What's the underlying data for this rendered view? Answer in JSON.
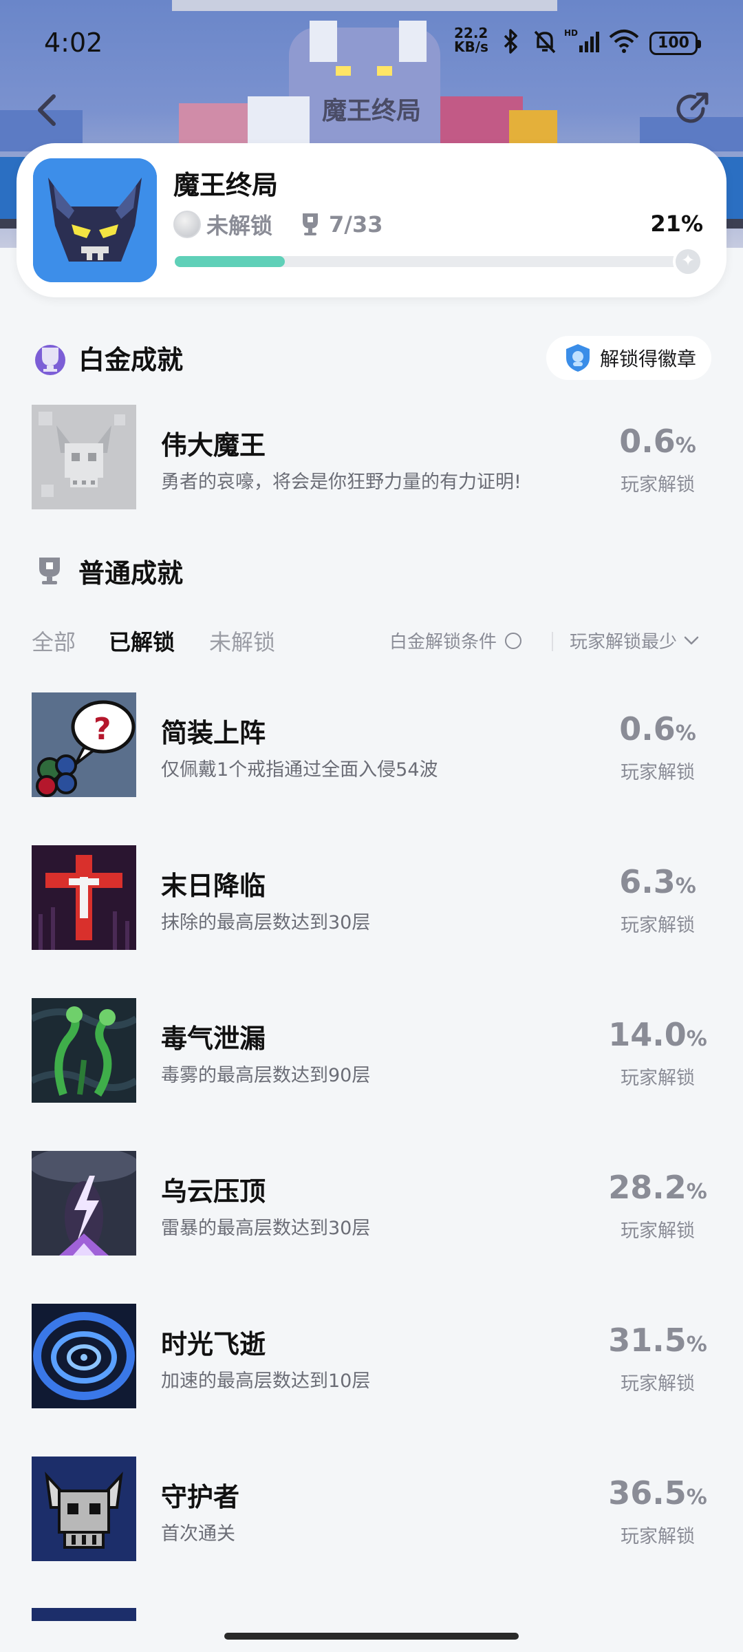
{
  "status_bar": {
    "time": "4:02",
    "net_speed_top": "22.2",
    "net_speed_unit": "KB/s",
    "battery": "100"
  },
  "nav": {
    "title": "魔王终局"
  },
  "game": {
    "name": "魔王终局",
    "platinum_status": "未解锁",
    "trophy_progress": "7/33",
    "percent_text": "21%",
    "progress_fraction": 0.21
  },
  "platinum_section": {
    "title": "白金成就",
    "badge_button": "解锁得徽章",
    "item": {
      "name": "伟大魔王",
      "desc": "勇者的哀嚎，将会是你狂野力量的有力证明!",
      "rate": "0.6",
      "pct": "%",
      "rate_label": "玩家解锁"
    }
  },
  "normal_section": {
    "title": "普通成就",
    "tabs": [
      "全部",
      "已解锁",
      "未解锁"
    ],
    "active_tab_index": 1,
    "condition_label": "白金解锁条件",
    "sort_label": "玩家解锁最少"
  },
  "achievements": [
    {
      "name": "简装上阵",
      "desc": "仅佩戴1个戒指通过全面入侵54波",
      "rate": "0.6",
      "pct": "%",
      "rate_label": "玩家解锁"
    },
    {
      "name": "末日降临",
      "desc": "抹除的最高层数达到30层",
      "rate": "6.3",
      "pct": "%",
      "rate_label": "玩家解锁"
    },
    {
      "name": "毒气泄漏",
      "desc": "毒雾的最高层数达到90层",
      "rate": "14.0",
      "pct": "%",
      "rate_label": "玩家解锁"
    },
    {
      "name": "乌云压顶",
      "desc": "雷暴的最高层数达到30层",
      "rate": "28.2",
      "pct": "%",
      "rate_label": "玩家解锁"
    },
    {
      "name": "时光飞逝",
      "desc": "加速的最高层数达到10层",
      "rate": "31.5",
      "pct": "%",
      "rate_label": "玩家解锁"
    },
    {
      "name": "守护者",
      "desc": "首次通关",
      "rate": "36.5",
      "pct": "%",
      "rate_label": "玩家解锁"
    }
  ],
  "icons": {
    "back": "back-arrow-icon",
    "share": "share-icon",
    "trophy": "trophy-icon",
    "platinum": "platinum-trophy-icon",
    "badge": "shield-badge-icon",
    "chevron": "chevron-down-icon"
  },
  "colors": {
    "progress_fill": "#5fd0b8",
    "page_bg": "#f4f6f8",
    "rate_gray": "#8a8c96"
  }
}
